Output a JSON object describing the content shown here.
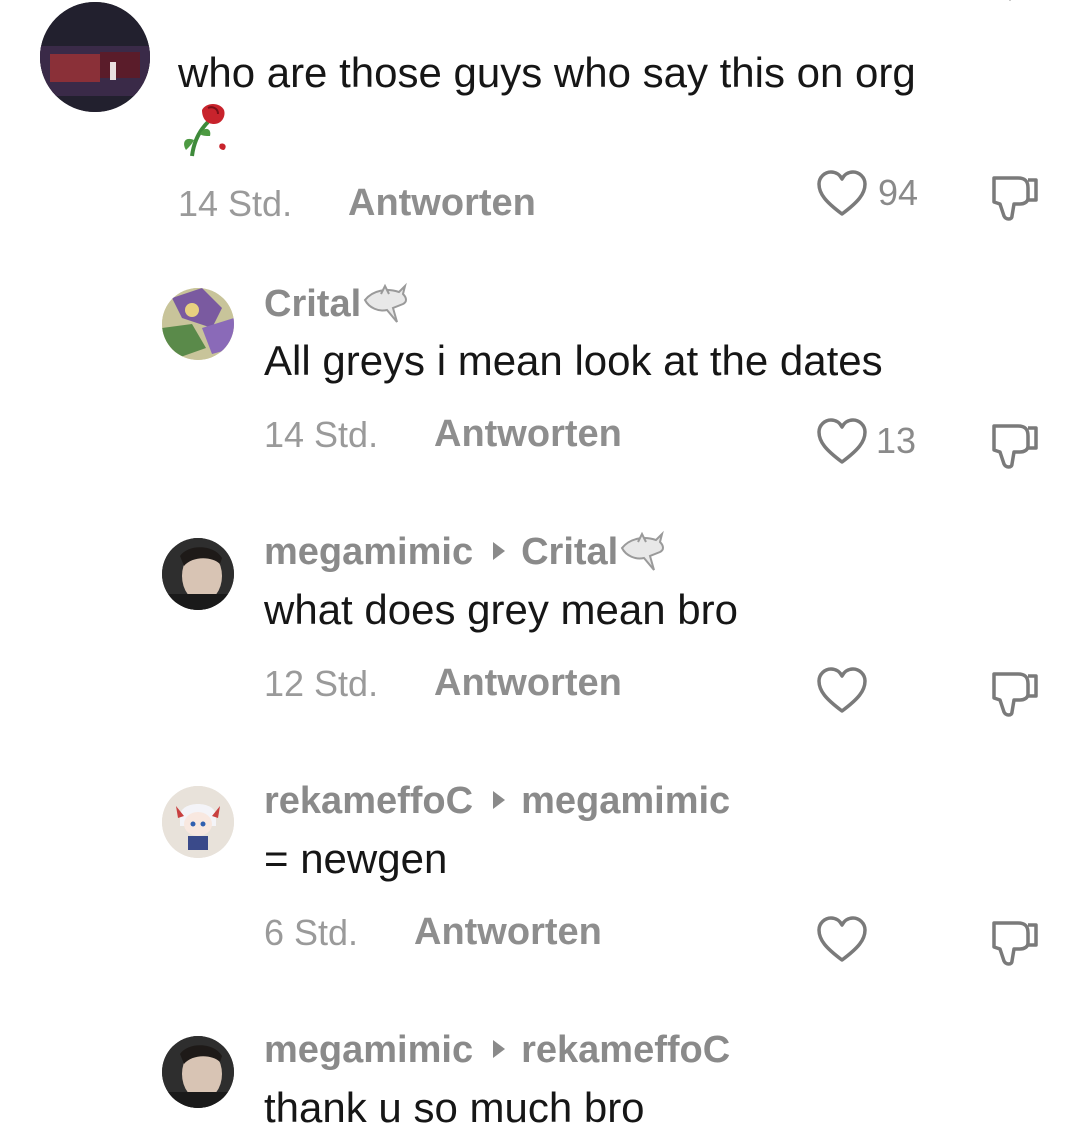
{
  "comments": [
    {
      "author": "",
      "reply_to": "",
      "text": "who are those guys who say this on org",
      "time": "14 Std.",
      "reply_label": "Antworten",
      "likes": "94",
      "avatar_icon": "dark-photo-avatar",
      "emoji_icon": "wilted-rose-icon"
    },
    {
      "author": "Crital",
      "author_badge_icon": "shark-icon",
      "reply_to": "",
      "text": "All greys i mean look at the dates",
      "time": "14 Std.",
      "reply_label": "Antworten",
      "likes": "13",
      "avatar_icon": "anime-art-avatar"
    },
    {
      "author": "megamimic",
      "reply_to": "Crital",
      "reply_to_badge_icon": "shark-icon",
      "text": "what does grey mean bro",
      "time": "12 Std.",
      "reply_label": "Antworten",
      "likes": "",
      "avatar_icon": "person-photo-avatar"
    },
    {
      "author": "rekameffoC",
      "reply_to": "megamimic",
      "text": "= newgen",
      "time": "6 Std.",
      "reply_label": "Antworten",
      "likes": "",
      "avatar_icon": "chibi-character-avatar"
    },
    {
      "author": "megamimic",
      "reply_to": "rekameffoC",
      "text": "thank u so much bro",
      "avatar_icon": "person-photo-avatar"
    }
  ],
  "colors": {
    "text": "#161616",
    "secondary": "#8a8a8a",
    "background": "#ffffff"
  }
}
